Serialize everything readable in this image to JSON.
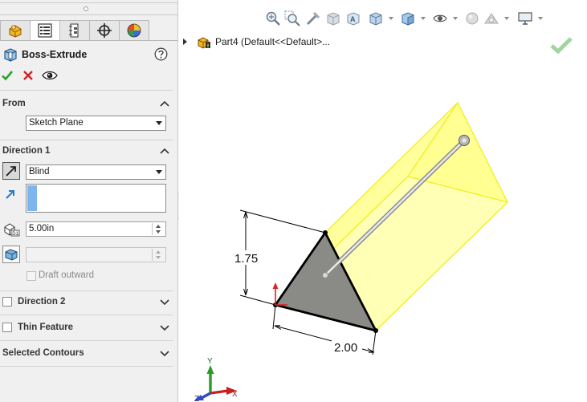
{
  "property_manager": {
    "feature_title": "Boss-Extrude",
    "tabs": [
      {
        "name": "featuremanager-tab"
      },
      {
        "name": "propertymanager-tab"
      },
      {
        "name": "configurationmanager-tab"
      },
      {
        "name": "dimxpertmanager-tab"
      },
      {
        "name": "displaymanager-tab"
      }
    ],
    "from": {
      "header": "From",
      "start_condition": "Sketch Plane"
    },
    "direction1": {
      "header": "Direction 1",
      "end_condition": "Blind",
      "depth": "5.00in",
      "draft_outward_label": "Draft outward"
    },
    "direction2": {
      "header": "Direction 2"
    },
    "thin_feature": {
      "header": "Thin Feature"
    },
    "selected_contours": {
      "header": "Selected Contours"
    }
  },
  "graphics": {
    "tree_label": "Part4  (Default<<Default>...",
    "dimension_height": "1.75",
    "dimension_width": "2.00",
    "triad": {
      "x": "X",
      "y": "Y",
      "z": "Z"
    },
    "colors": {
      "preview_yellow": "#ffff7a",
      "preview_edge": "#f2ee1a",
      "profile_face": "#8a8a86",
      "accept_green": "#2aa02a",
      "cancel_red": "#d42020"
    }
  }
}
